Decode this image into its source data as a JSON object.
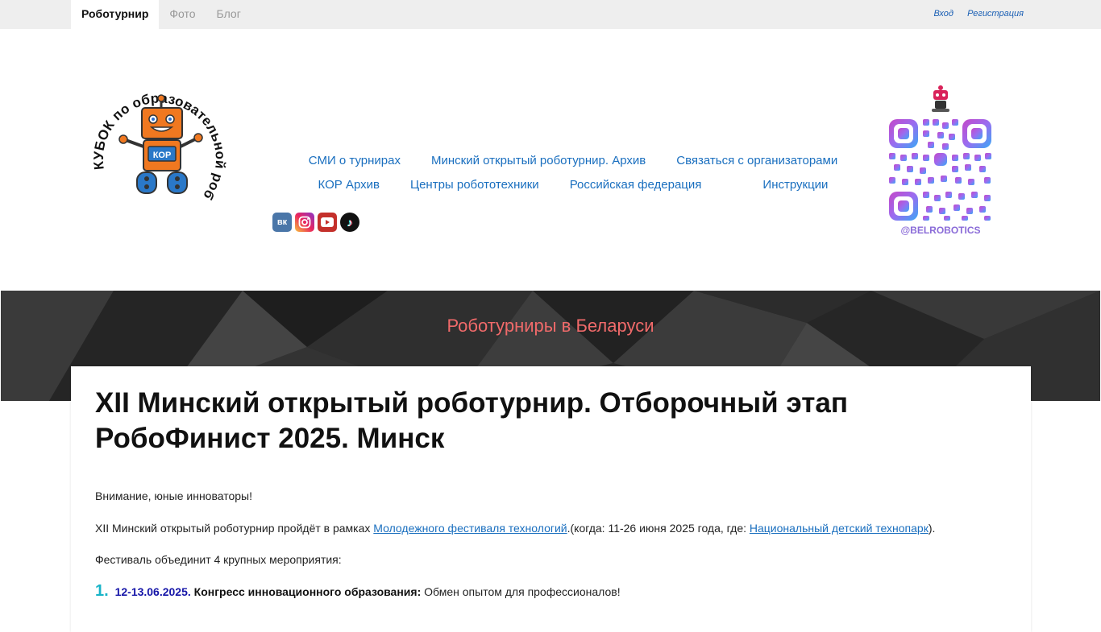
{
  "topnav": {
    "items": [
      {
        "label": "Роботурнир",
        "active": true
      },
      {
        "label": "Фото",
        "active": false
      },
      {
        "label": "Блог",
        "active": false
      }
    ],
    "login": "Вход",
    "register": "Регистрация"
  },
  "logo": {
    "arc_text": "КУБОК по образовательной робототехнике",
    "robot_label": "КОР"
  },
  "menu": {
    "row1": [
      "СМИ о турнирах",
      "Минский открытый роботурнир. Архив",
      "Связаться с организаторами"
    ],
    "row2": [
      "КОР Архив",
      "Центры робототехники",
      "Российская федерация",
      "Инструкции"
    ]
  },
  "social": [
    {
      "icon": "vk-icon",
      "color": "#4a76a8",
      "glyph": "вк"
    },
    {
      "icon": "instagram-icon",
      "color": "#d6287a",
      "glyph": "◎"
    },
    {
      "icon": "youtube-icon",
      "color": "#d81e1e",
      "glyph": "▶"
    },
    {
      "icon": "tiktok-icon",
      "color": "#111111",
      "glyph": "♪"
    }
  ],
  "qr": {
    "handle": "@BELROBOTICS"
  },
  "banner": {
    "title": "Роботурниры в Беларуси"
  },
  "article": {
    "title": "XII Минский открытый роботурнир. Отборочный этап РобоФинист 2025. Минск",
    "p1": "Внимание, юные инноваторы!",
    "p2_before": "XII Минский открытый роботурнир пройдёт в рамках ",
    "p2_link1": "Молодежного фестиваля технологий",
    "p2_middle": ".(когда: 11-26 июня 2025 года,  где: ",
    "p2_link2": "Национальный детский технопарк",
    "p2_after": ").",
    "p3": "Фестиваль объединит 4 крупных мероприятия:",
    "item1": {
      "num": "1.",
      "date": "12-13.06.2025.",
      "name": "Конгресс инновационного образования:",
      "desc": "Обмен опытом для профессионалов!"
    }
  },
  "colors": {
    "accent_link": "#1a6fbf",
    "banner_text": "#f06a6a",
    "list_number": "#19b4c8",
    "list_date": "#1515a8"
  }
}
